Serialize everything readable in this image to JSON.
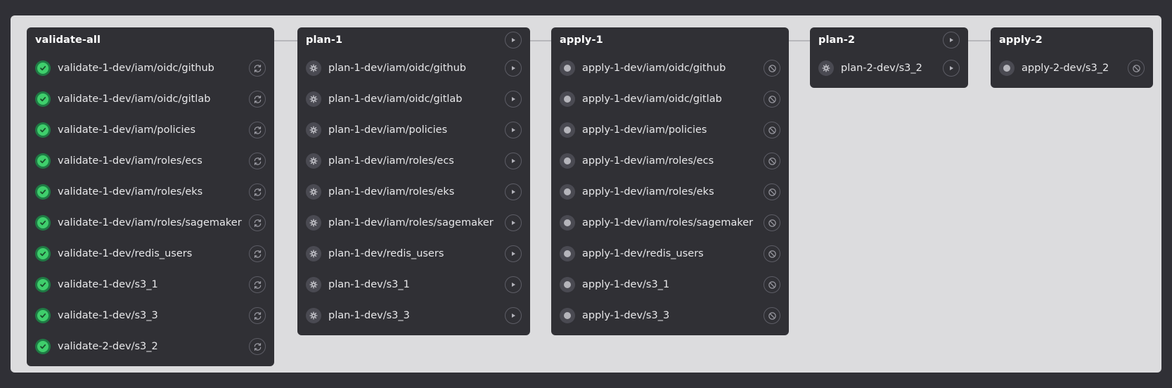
{
  "stages": [
    {
      "title": "validate-all",
      "status": "success",
      "job_action": "retry",
      "jobs": [
        "validate-1-dev/iam/oidc/github",
        "validate-1-dev/iam/oidc/gitlab",
        "validate-1-dev/iam/policies",
        "validate-1-dev/iam/roles/ecs",
        "validate-1-dev/iam/roles/eks",
        "validate-1-dev/iam/roles/sagemaker",
        "validate-1-dev/redis_users",
        "validate-1-dev/s3_1",
        "validate-1-dev/s3_3",
        "validate-2-dev/s3_2"
      ]
    },
    {
      "title": "plan-1",
      "status": "manual",
      "job_action": "play",
      "header_action": "play",
      "jobs": [
        "plan-1-dev/iam/oidc/github",
        "plan-1-dev/iam/oidc/gitlab",
        "plan-1-dev/iam/policies",
        "plan-1-dev/iam/roles/ecs",
        "plan-1-dev/iam/roles/eks",
        "plan-1-dev/iam/roles/sagemaker",
        "plan-1-dev/redis_users",
        "plan-1-dev/s3_1",
        "plan-1-dev/s3_3"
      ]
    },
    {
      "title": "apply-1",
      "status": "created",
      "job_action": "cancel",
      "jobs": [
        "apply-1-dev/iam/oidc/github",
        "apply-1-dev/iam/oidc/gitlab",
        "apply-1-dev/iam/policies",
        "apply-1-dev/iam/roles/ecs",
        "apply-1-dev/iam/roles/eks",
        "apply-1-dev/iam/roles/sagemaker",
        "apply-1-dev/redis_users",
        "apply-1-dev/s3_1",
        "apply-1-dev/s3_3"
      ]
    },
    {
      "title": "plan-2",
      "status": "manual",
      "job_action": "play",
      "header_action": "play",
      "jobs": [
        "plan-2-dev/s3_2"
      ]
    },
    {
      "title": "apply-2",
      "status": "created",
      "job_action": "cancel",
      "jobs": [
        "apply-2-dev/s3_2"
      ]
    }
  ],
  "colors": {
    "success": "#3fcf6c",
    "canvas": "#dcdcde",
    "stage_bg": "#303035"
  }
}
